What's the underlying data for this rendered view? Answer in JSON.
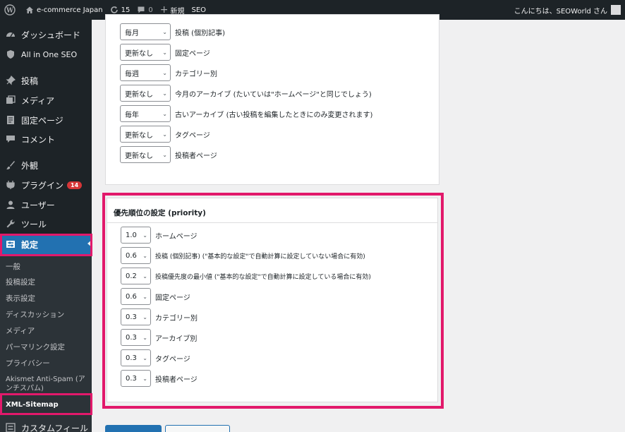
{
  "admin_bar": {
    "site_name": "e-commerce Japan",
    "updates_count": "15",
    "comments_count": "0",
    "new_label": "新規",
    "seo_label": "SEO",
    "greeting": "こんにちは、SEOWorld さん"
  },
  "sidebar": {
    "items": [
      {
        "label": "ダッシュボード",
        "icon": "gauge-icon"
      },
      {
        "label": "All in One SEO",
        "icon": "shield-icon"
      },
      {
        "label": "投稿",
        "icon": "pin-icon"
      },
      {
        "label": "メディア",
        "icon": "media-icon"
      },
      {
        "label": "固定ページ",
        "icon": "page-icon"
      },
      {
        "label": "コメント",
        "icon": "comment-icon"
      },
      {
        "label": "外観",
        "icon": "brush-icon"
      },
      {
        "label": "プラグイン",
        "icon": "plugin-icon",
        "badge": "14"
      },
      {
        "label": "ユーザー",
        "icon": "user-icon"
      },
      {
        "label": "ツール",
        "icon": "wrench-icon"
      },
      {
        "label": "設定",
        "icon": "settings-icon",
        "current": true
      }
    ],
    "submenu": [
      {
        "label": "一般"
      },
      {
        "label": "投稿設定"
      },
      {
        "label": "表示設定"
      },
      {
        "label": "ディスカッション"
      },
      {
        "label": "メディア"
      },
      {
        "label": "パーマリンク設定"
      },
      {
        "label": "プライバシー"
      },
      {
        "label": "Akismet Anti-Spam (ア",
        "label2": "ンチスパム)"
      },
      {
        "label": "XML-Sitemap",
        "current": true
      }
    ],
    "last_item": {
      "label": "カスタムフィール",
      "icon": "custom-fields-icon"
    }
  },
  "frequency_panel": {
    "rows": [
      {
        "value": "毎月",
        "label": "投稿 (個別記事)"
      },
      {
        "value": "更新なし",
        "label": "固定ページ"
      },
      {
        "value": "毎週",
        "label": "カテゴリー別"
      },
      {
        "value": "更新なし",
        "label": "今月のアーカイブ (たいていは\"ホームページ\"と同じでしょう)"
      },
      {
        "value": "毎年",
        "label": "古いアーカイブ (古い投稿を編集したときにのみ変更されます)"
      },
      {
        "value": "更新なし",
        "label": "タグページ"
      },
      {
        "value": "更新なし",
        "label": "投稿者ページ"
      }
    ]
  },
  "priority_panel": {
    "title": "優先順位の設定 (priority)",
    "rows": [
      {
        "value": "1.0",
        "label": "ホームページ"
      },
      {
        "value": "0.6",
        "label": "投稿 (個別記事) (\"基本的な設定\"で自動計算に設定していない場合に有効)"
      },
      {
        "value": "0.2",
        "label": "投稿優先度の最小値 (\"基本的な設定\"で自動計算に設定している場合に有効)"
      },
      {
        "value": "0.6",
        "label": "固定ページ"
      },
      {
        "value": "0.3",
        "label": "カテゴリー別"
      },
      {
        "value": "0.3",
        "label": "アーカイブ別"
      },
      {
        "value": "0.3",
        "label": "タグページ"
      },
      {
        "value": "0.3",
        "label": "投稿者ページ"
      }
    ]
  },
  "colors": {
    "admin_dark": "#1d2327",
    "submenu_bg": "#2c3338",
    "wp_blue": "#2271b1",
    "highlight_magenta": "#e2196b",
    "badge_red": "#d63638"
  }
}
